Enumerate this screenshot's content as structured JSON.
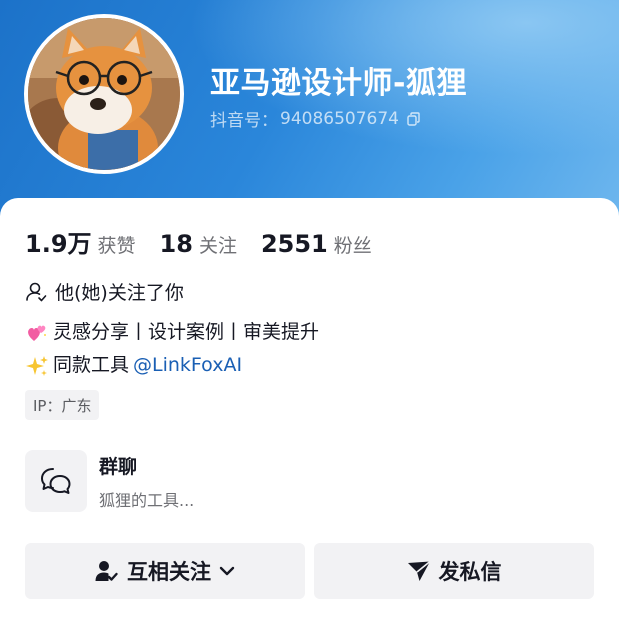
{
  "profile": {
    "nickname": "亚马逊设计师-狐狸",
    "douyin_id_label": "抖音号：",
    "douyin_id": "94086507674"
  },
  "stats": [
    {
      "value": "1.9万",
      "label": "获赞"
    },
    {
      "value": "18",
      "label": "关注"
    },
    {
      "value": "2551",
      "label": "粉丝"
    }
  ],
  "follow_status": "他(她)关注了你",
  "bio": {
    "line1": "灵感分享丨设计案例丨审美提升",
    "line2_text": "同款工具",
    "line2_mention": "@LinkFoxAI"
  },
  "ip_location": "IP：广东",
  "group_chat": {
    "title": "群聊",
    "description": "狐狸的工具..."
  },
  "buttons": {
    "mutual_follow": "互相关注",
    "send_message": "发私信"
  },
  "icons": {
    "copy": "copy-icon",
    "person": "person-icon",
    "heart": "sparkling-hearts-emoji",
    "sparkles": "sparkles-emoji",
    "chat": "chat-bubbles-icon",
    "mutual_follow": "person-check-icon",
    "chevron": "chevron-down-icon",
    "send": "paper-plane-icon"
  },
  "colors": {
    "header_blue": "#2a86da",
    "mention_blue": "#1a5fb4",
    "button_bg": "#f2f2f4"
  }
}
